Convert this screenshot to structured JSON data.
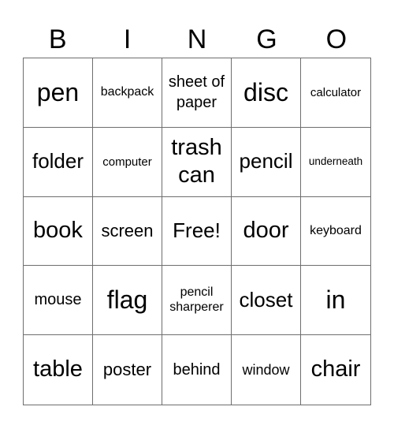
{
  "header": {
    "letters": [
      "B",
      "I",
      "N",
      "G",
      "O"
    ]
  },
  "board": {
    "rows": [
      [
        "pen",
        "backpack",
        "sheet of paper",
        "disc",
        "calculator"
      ],
      [
        "folder",
        "computer",
        "trash can",
        "pencil",
        "underneath"
      ],
      [
        "book",
        "screen",
        "Free!",
        "door",
        "keyboard"
      ],
      [
        "mouse",
        "flag",
        "pencil sharperer",
        "closet",
        "in"
      ],
      [
        "table",
        "poster",
        "behind",
        "window",
        "chair"
      ]
    ]
  }
}
